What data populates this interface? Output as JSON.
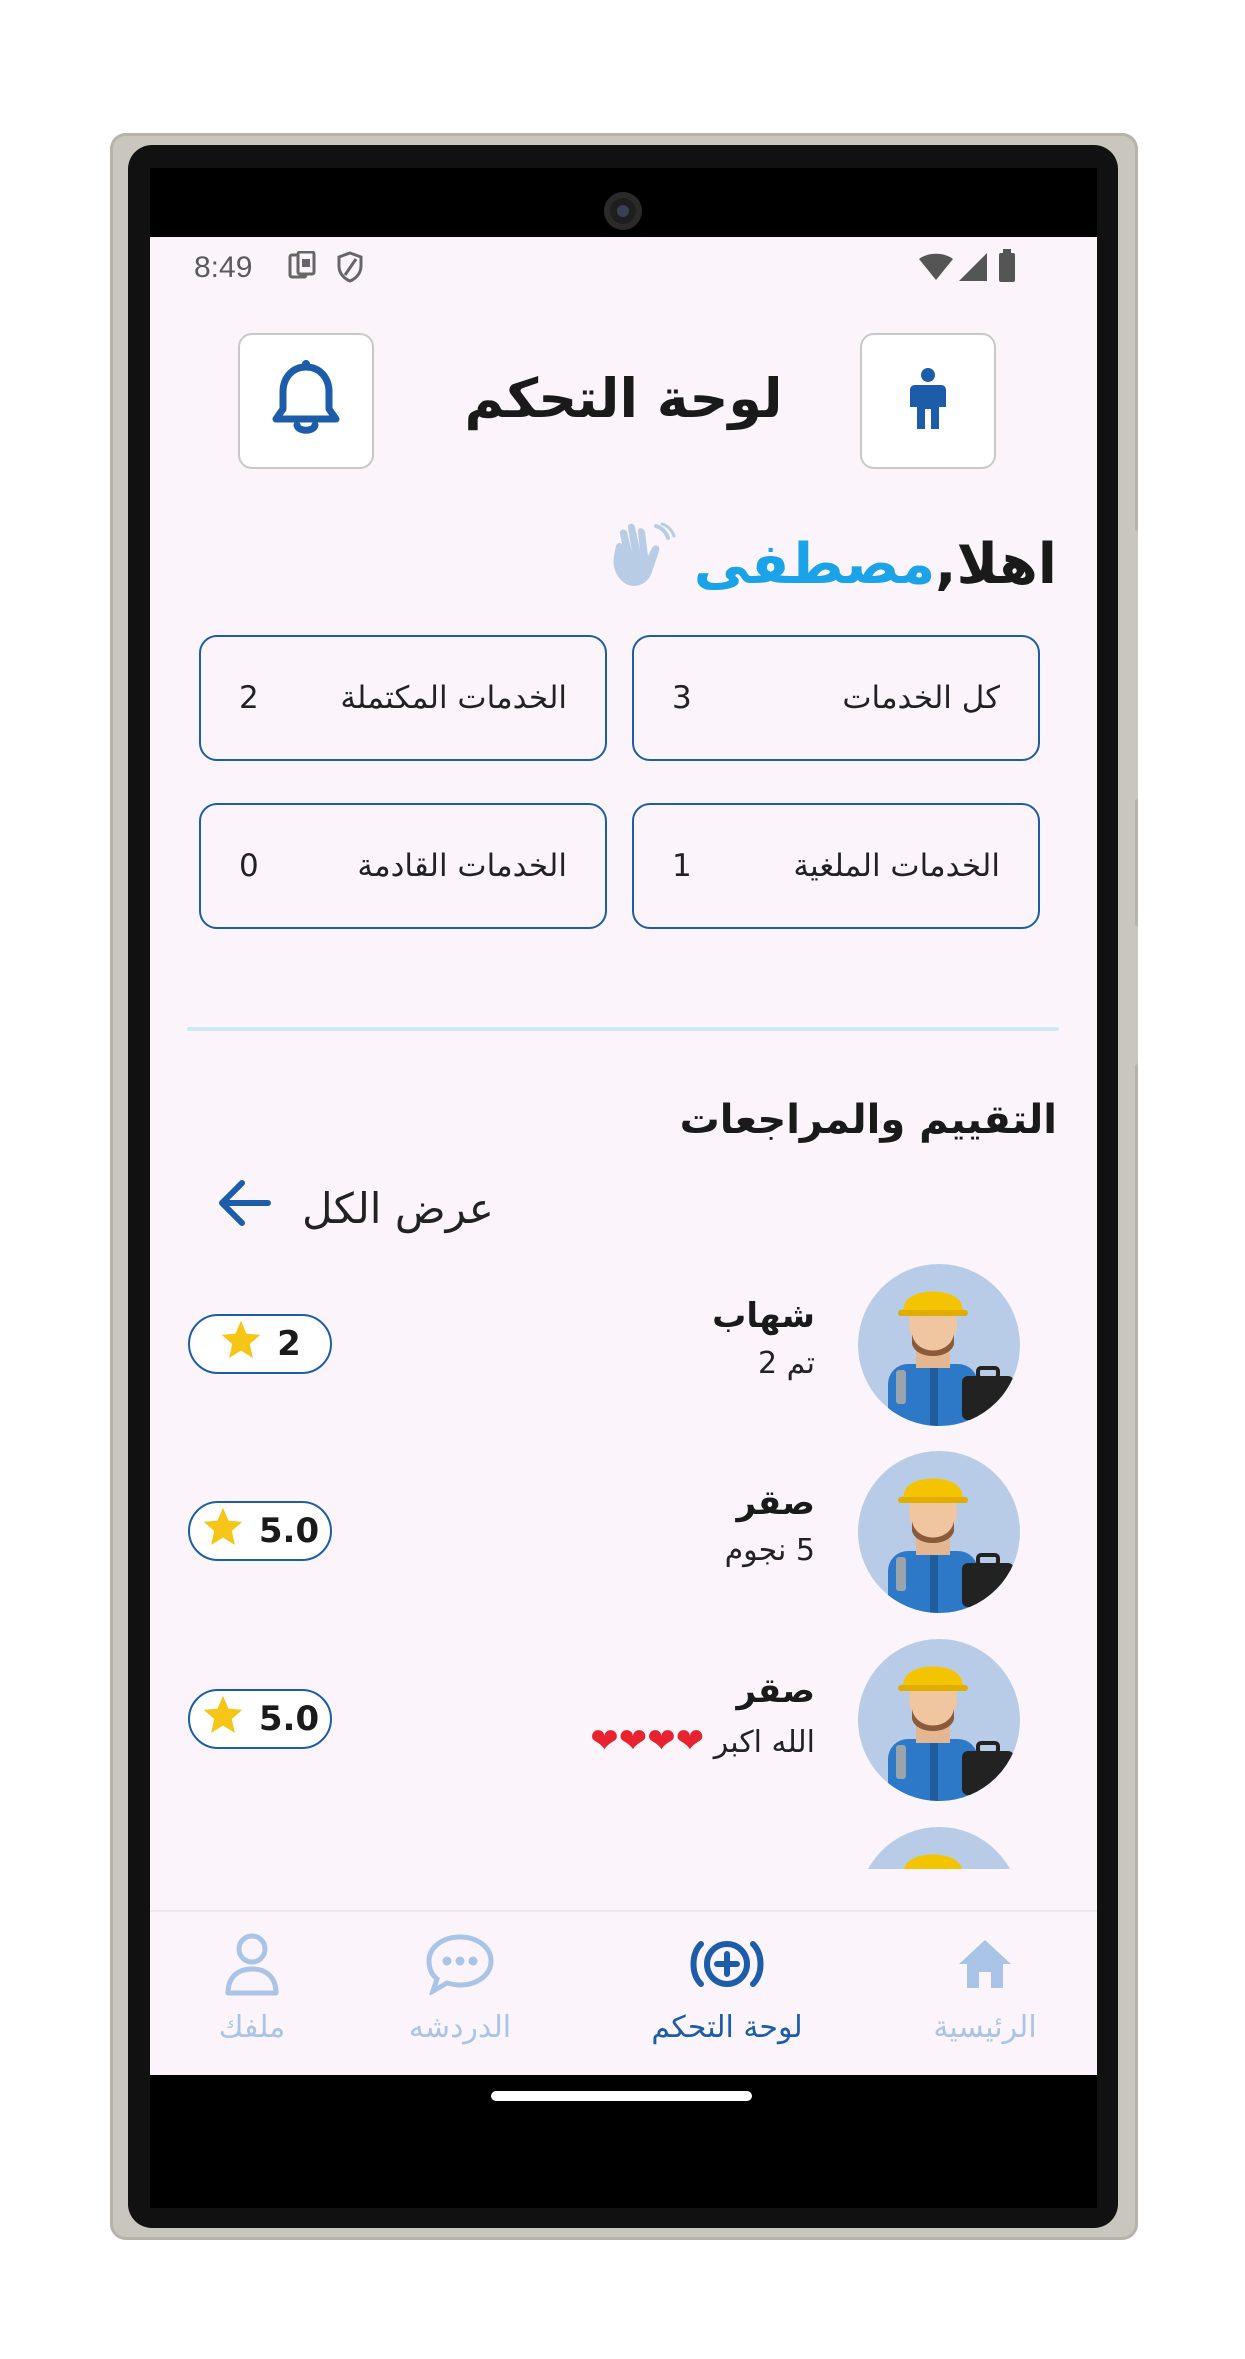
{
  "status_bar": {
    "time": "8:49"
  },
  "header": {
    "title": "لوحة التحكم",
    "profile_icon": "person-icon",
    "bell_icon": "bell-icon"
  },
  "greeting": {
    "hello": "اهلا,",
    "name": "مصطفى",
    "wave_icon": "waving-hand-icon"
  },
  "stats": [
    {
      "label": "كل الخدمات",
      "count": "3"
    },
    {
      "label": "الخدمات المكتملة",
      "count": "2"
    },
    {
      "label": "الخدمات الملغية",
      "count": "1"
    },
    {
      "label": "الخدمات القادمة",
      "count": "0"
    }
  ],
  "reviews_section": {
    "title": "التقييم والمراجعات",
    "see_all": "عرض الكل"
  },
  "reviews": [
    {
      "name": "شهاب",
      "text": "تم 2",
      "rating": "2"
    },
    {
      "name": "صقر",
      "text": "5 نجوم",
      "rating": "5.0"
    },
    {
      "name": "صقر",
      "text": "الله اكبر",
      "hearts": "❤❤❤❤",
      "rating": "5.0"
    }
  ],
  "bottom_nav": [
    {
      "label": "الرئيسية",
      "icon": "home-icon"
    },
    {
      "label": "لوحة التحكم",
      "icon": "dashboard-plus-icon",
      "active": true
    },
    {
      "label": "الدردشه",
      "icon": "chat-icon"
    },
    {
      "label": "ملفك",
      "icon": "user-icon"
    }
  ],
  "colors": {
    "primary": "#1c5ca8",
    "accent": "#1aa3e8",
    "background": "#fbf5fb",
    "inactive_nav": "#a9c4e6",
    "star": "#f5c518",
    "heart": "#e8232f"
  }
}
